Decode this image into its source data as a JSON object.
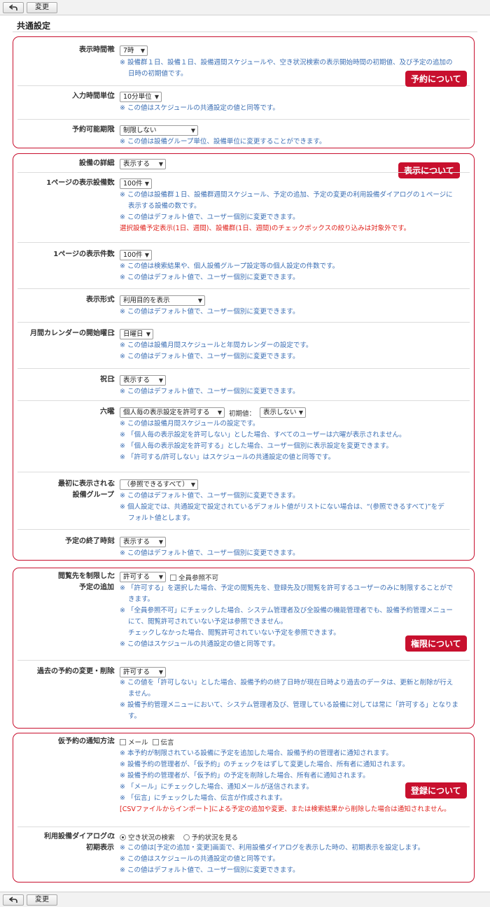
{
  "toolbar": {
    "back_icon": "back-arrow-icon",
    "change_label": "変更"
  },
  "page_title": "共通設定",
  "colors": {
    "accent": "#c8102e",
    "note": "#3c6fb4",
    "warning": "#e0201a"
  },
  "reservation": {
    "badge": "予約について",
    "display_time": {
      "label": "表示時間帯",
      "value": "7時",
      "notes": [
        "※ 設備群１日、設備１日、設備週間スケジュールや、空き状況検索の表示開始時間の初期値、及び予定の追加の",
        "日時の初期値です。"
      ]
    },
    "input_unit": {
      "label": "入力時間単位",
      "value": "10分単位",
      "notes": [
        "※ この値はスケジュールの共通設定の値と同等です。"
      ]
    },
    "period": {
      "label": "予約可能期限",
      "value": "制限しない",
      "notes": [
        "※ この値は設備グループ単位、設備単位に変更することができます。"
      ]
    }
  },
  "display": {
    "badge": "表示について",
    "detail": {
      "label": "設備の詳細",
      "value": "表示する"
    },
    "per_page_equipment": {
      "label": "1ページの表示設備数",
      "value": "100件",
      "notes": [
        "※ この値は設備群１日、設備群週間スケジュール、予定の追加、予定の変更の利用設備ダイアログの１ページに",
        "表示する設備の数です。",
        "※ この値はデフォルト値で、ユーザー個別に変更できます。"
      ],
      "warning": "選択設備予定表示(1日、週間)、設備群(1日、週間)のチェックボックスの絞り込みは対象外です。"
    },
    "per_page_items": {
      "label": "1ページの表示件数",
      "value": "100件",
      "notes": [
        "※ この値は検索結果や、個人設備グループ設定等の個人設定の件数です。",
        "※ この値はデフォルト値で、ユーザー個別に変更できます。"
      ]
    },
    "format": {
      "label": "表示形式",
      "value": "利用目的を表示",
      "notes": [
        "※ この値はデフォルト値で、ユーザー個別に変更できます。"
      ]
    },
    "week_start": {
      "label": "月間カレンダーの開始曜日",
      "value": "日曜日",
      "notes": [
        "※ この値は設備月間スケジュールと年間カレンダーの設定です。",
        "※ この値はデフォルト値で、ユーザー個別に変更できます。"
      ]
    },
    "holiday": {
      "label": "祝日",
      "value": "表示する",
      "notes": [
        "※ この値はデフォルト値で、ユーザー個別に変更できます。"
      ]
    },
    "rokuyo": {
      "label": "六曜",
      "value": "個人毎の表示設定を許可する",
      "initial_label": "初期値：",
      "initial_value": "表示しない",
      "notes": [
        "※ この値は設備月間スケジュールの設定です。",
        "※ 「個人毎の表示設定を許可しない」とした場合、すべてのユーザーは六曜が表示されません。",
        "※ 「個人毎の表示設定を許可する」とした場合、ユーザー個別に表示設定を変更できます。",
        "※ 「許可する/許可しない」はスケジュールの共通設定の値と同等です。"
      ]
    },
    "first_group": {
      "label1": "最初に表示される",
      "label2": "設備グループ",
      "value": "（参照できるすべて）",
      "notes": [
        "※ この値はデフォルト値で、ユーザー個別に変更できます。",
        "※ 個人設定では、共通設定で設定されているデフォルト値がリストにない場合は、“(参照できるすべて)”をデ",
        "フォルト値とします。"
      ]
    },
    "end_time": {
      "label": "予定の終了時刻",
      "value": "表示する",
      "notes": [
        "※ この値はデフォルト値で、ユーザー個別に変更できます。"
      ]
    }
  },
  "permission": {
    "badge": "権限について",
    "restrict_view": {
      "label1": "閲覧先を制限した",
      "label2": "予定の追加",
      "value": "許可する",
      "checkbox": "全員参照不可",
      "notes": [
        "※ 「許可する」を選択した場合、予定の閲覧先を、登録先及び閲覧を許可するユーザーのみに制限することがで",
        "きます。",
        "※ 「全員参照不可」にチェックした場合、システム管理者及び全設備の機能管理者でも、設備予約管理メニュー",
        "にて、閲覧許可されていない予定は参照できません。",
        "チェックしなかった場合、閲覧許可されていない予定を参照できます。",
        "※ この値はスケジュールの共通設定の値と同等です。"
      ]
    },
    "past_change": {
      "label": "過去の予約の変更・削除",
      "value": "許可する",
      "notes": [
        "※ この値を「許可しない」とした場合、設備予約の終了日時が現在日時より過去のデータは、更新と削除が行え",
        "ません。",
        "※ 設備予約管理メニューにおいて、システム管理者及び、管理している設備に対しては常に「許可する」となりま",
        "す。"
      ]
    }
  },
  "registration": {
    "badge": "登録について",
    "notify": {
      "label": "仮予約の通知方法",
      "opt_mail": "メール",
      "opt_message": "伝言",
      "notes": [
        "※ 本予約が制限されている設備に予定を追加した場合、設備予約の管理者に通知されます。",
        "※ 設備予約の管理者が、「仮予約」のチェックをはずして変更した場合、所有者に通知されます。",
        "※ 設備予約の管理者が、「仮予約」の予定を削除した場合、所有者に通知されます。",
        "※ 「メール」にチェックした場合、通知メールが送信されます。",
        "※ 「伝言」にチェックした場合、伝言が作成されます。"
      ],
      "warning": "[CSVファイルからインポート]による予定の追加や変更、または検索結果から削除した場合は通知されません。"
    },
    "dialog": {
      "label1": "利用設備ダイアログの",
      "label2": "初期表示",
      "opt_vacancy": "空き状況の検索",
      "opt_status": "予約状況を見る",
      "notes": [
        "※ この値は[予定の追加・変更]画面で、利用設備ダイアログを表示した時の、初期表示を設定します。",
        "※ この値はスケジュールの共通設定の値と同等です。",
        "※ この値はデフォルト値で、ユーザー個別に変更できます。"
      ]
    }
  }
}
